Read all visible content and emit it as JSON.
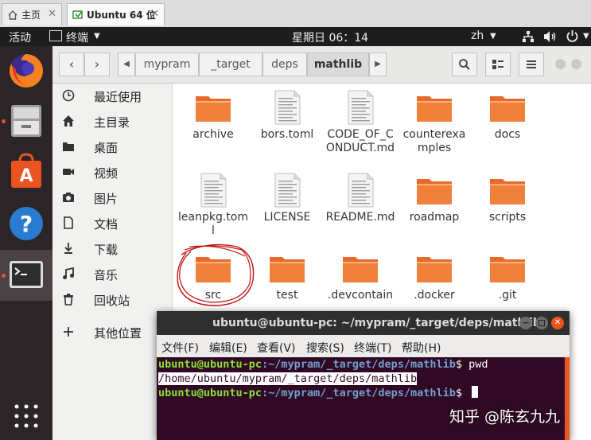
{
  "vm_tabs": [
    {
      "label": "主页"
    },
    {
      "label": "Ubuntu 64 位"
    }
  ],
  "top_panel": {
    "activities": "活动",
    "app_menu": "终端",
    "clock": "星期日 06：14",
    "input_method": "zh"
  },
  "nautilus": {
    "breadcrumbs": [
      "mypram",
      "_target",
      "deps",
      "mathlib"
    ],
    "sidebar": [
      {
        "label": "最近使用",
        "icon": "clock-icon"
      },
      {
        "label": "主目录",
        "icon": "home-icon"
      },
      {
        "label": "桌面",
        "icon": "desktop-folder-icon"
      },
      {
        "label": "视频",
        "icon": "video-icon"
      },
      {
        "label": "图片",
        "icon": "camera-icon"
      },
      {
        "label": "文档",
        "icon": "document-icon"
      },
      {
        "label": "下载",
        "icon": "download-icon"
      },
      {
        "label": "音乐",
        "icon": "music-icon"
      },
      {
        "label": "回收站",
        "icon": "trash-icon"
      },
      {
        "label": "其他位置",
        "icon": "plus-icon"
      }
    ],
    "files": [
      {
        "name": "archive",
        "type": "folder"
      },
      {
        "name": "bors.toml",
        "type": "file"
      },
      {
        "name": "CODE_OF_CONDUCT.md",
        "type": "file"
      },
      {
        "name": "counterexamples",
        "type": "folder"
      },
      {
        "name": "docs",
        "type": "folder"
      },
      {
        "name": "leanpkg.toml",
        "type": "file"
      },
      {
        "name": "LICENSE",
        "type": "file"
      },
      {
        "name": "README.md",
        "type": "file"
      },
      {
        "name": "roadmap",
        "type": "folder"
      },
      {
        "name": "scripts",
        "type": "folder"
      },
      {
        "name": "src",
        "type": "folder"
      },
      {
        "name": "test",
        "type": "folder"
      },
      {
        "name": ".devcontain",
        "type": "folder"
      },
      {
        "name": ".docker",
        "type": "folder"
      },
      {
        "name": ".git",
        "type": "folder"
      }
    ]
  },
  "terminal": {
    "title": "ubuntu@ubuntu-pc: ~/mypram/_target/deps/mathlib",
    "menu": [
      "文件(F)",
      "编辑(E)",
      "查看(V)",
      "搜索(S)",
      "终端(T)",
      "帮助(H)"
    ],
    "lines": [
      {
        "user": "ubuntu@ubuntu-pc",
        "path": ":~/mypram/_target/deps/mathlib",
        "cmd": "$ pwd"
      },
      {
        "output": "/home/ubuntu/mypram/_target/deps/mathlib"
      },
      {
        "user": "ubuntu@ubuntu-pc",
        "path": ":~/mypram/_target/deps/mathlib",
        "cmd": "$ "
      }
    ]
  },
  "watermark": "知乎 @陈玄九九",
  "colors": {
    "terminal_bg": "#300a24",
    "prompt_user": "#8ae234",
    "prompt_path": "#729fcf",
    "folder_orange": "#f0813b",
    "annotation_red": "#c01010"
  }
}
